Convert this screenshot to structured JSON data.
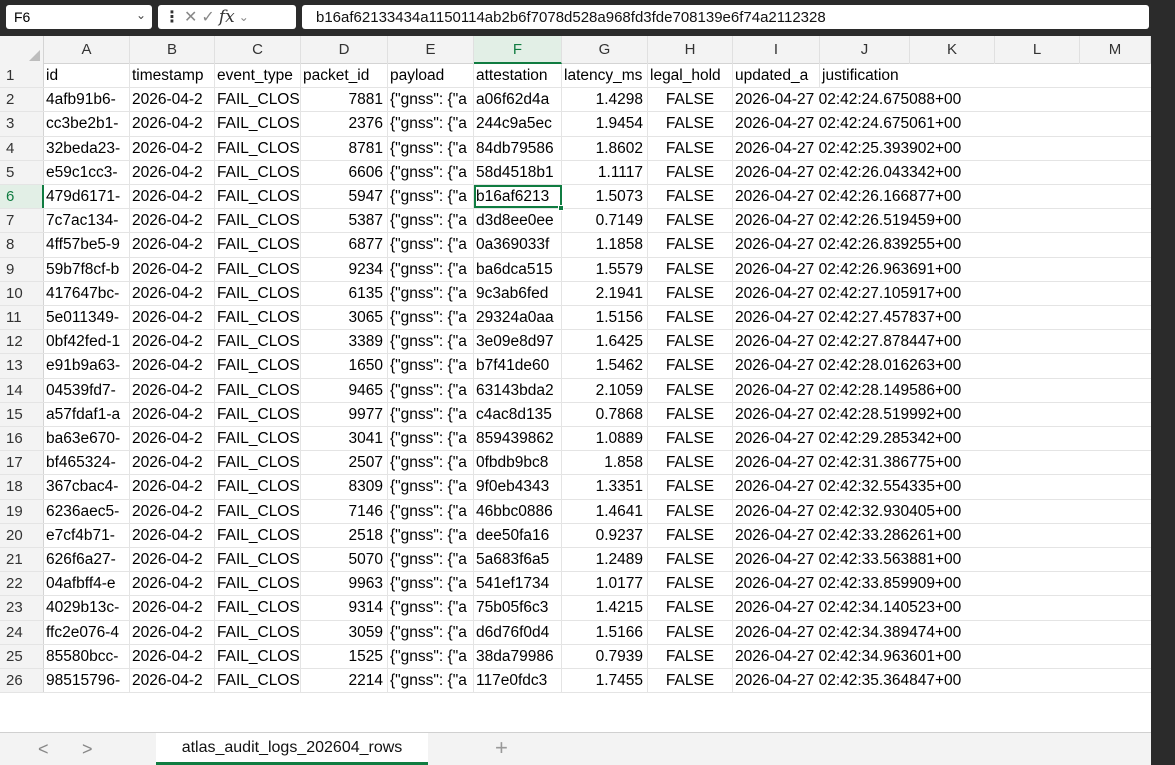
{
  "namebox": {
    "value": "F6"
  },
  "formula": {
    "value": "b16af62133434a1150114ab2b6f7078d528a968fd3fde708139e6f74a2112328",
    "fx_label": "fx"
  },
  "columns": [
    "A",
    "B",
    "C",
    "D",
    "E",
    "F",
    "G",
    "H",
    "I",
    "J",
    "K",
    "L",
    "M"
  ],
  "headers": [
    "id",
    "timestamp",
    "event_type",
    "packet_id",
    "payload",
    "attestation",
    "latency_ms",
    "legal_hold",
    "updated_a",
    "justification"
  ],
  "rows": [
    {
      "n": "2",
      "id": "4afb91b6-",
      "ts": "2026-04-2",
      "ev": "FAIL_CLOS",
      "pid": "7881",
      "pl": "{\"gnss\": {\"a",
      "att": "a06f62d4a",
      "lat": "1.4298",
      "lh": "FALSE",
      "upd": "2026-04-27 02:42:24.675088+00"
    },
    {
      "n": "3",
      "id": "cc3be2b1-",
      "ts": "2026-04-2",
      "ev": "FAIL_CLOS",
      "pid": "2376",
      "pl": "{\"gnss\": {\"a",
      "att": "244c9a5ec",
      "lat": "1.9454",
      "lh": "FALSE",
      "upd": "2026-04-27 02:42:24.675061+00"
    },
    {
      "n": "4",
      "id": "32beda23-",
      "ts": "2026-04-2",
      "ev": "FAIL_CLOS",
      "pid": "8781",
      "pl": "{\"gnss\": {\"a",
      "att": "84db79586",
      "lat": "1.8602",
      "lh": "FALSE",
      "upd": "2026-04-27 02:42:25.393902+00"
    },
    {
      "n": "5",
      "id": "e59c1cc3-",
      "ts": "2026-04-2",
      "ev": "FAIL_CLOS",
      "pid": "6606",
      "pl": "{\"gnss\": {\"a",
      "att": "58d4518b1",
      "lat": "1.1117",
      "lh": "FALSE",
      "upd": "2026-04-27 02:42:26.043342+00"
    },
    {
      "n": "6",
      "id": "479d6171-",
      "ts": "2026-04-2",
      "ev": "FAIL_CLOS",
      "pid": "5947",
      "pl": "{\"gnss\": {\"a",
      "att": "b16af6213",
      "lat": "1.5073",
      "lh": "FALSE",
      "upd": "2026-04-27 02:42:26.166877+00"
    },
    {
      "n": "7",
      "id": "7c7ac134-",
      "ts": "2026-04-2",
      "ev": "FAIL_CLOS",
      "pid": "5387",
      "pl": "{\"gnss\": {\"a",
      "att": "d3d8ee0ee",
      "lat": "0.7149",
      "lh": "FALSE",
      "upd": "2026-04-27 02:42:26.519459+00"
    },
    {
      "n": "8",
      "id": "4ff57be5-9",
      "ts": "2026-04-2",
      "ev": "FAIL_CLOS",
      "pid": "6877",
      "pl": "{\"gnss\": {\"a",
      "att": "0a369033f",
      "lat": "1.1858",
      "lh": "FALSE",
      "upd": "2026-04-27 02:42:26.839255+00"
    },
    {
      "n": "9",
      "id": "59b7f8cf-b",
      "ts": "2026-04-2",
      "ev": "FAIL_CLOS",
      "pid": "9234",
      "pl": "{\"gnss\": {\"a",
      "att": "ba6dca515",
      "lat": "1.5579",
      "lh": "FALSE",
      "upd": "2026-04-27 02:42:26.963691+00"
    },
    {
      "n": "10",
      "id": "417647bc-",
      "ts": "2026-04-2",
      "ev": "FAIL_CLOS",
      "pid": "6135",
      "pl": "{\"gnss\": {\"a",
      "att": "9c3ab6fed",
      "lat": "2.1941",
      "lh": "FALSE",
      "upd": "2026-04-27 02:42:27.105917+00"
    },
    {
      "n": "11",
      "id": "5e011349-",
      "ts": "2026-04-2",
      "ev": "FAIL_CLOS",
      "pid": "3065",
      "pl": "{\"gnss\": {\"a",
      "att": "29324a0aa",
      "lat": "1.5156",
      "lh": "FALSE",
      "upd": "2026-04-27 02:42:27.457837+00"
    },
    {
      "n": "12",
      "id": "0bf42fed-1",
      "ts": "2026-04-2",
      "ev": "FAIL_CLOS",
      "pid": "3389",
      "pl": "{\"gnss\": {\"a",
      "att": "3e09e8d97",
      "lat": "1.6425",
      "lh": "FALSE",
      "upd": "2026-04-27 02:42:27.878447+00"
    },
    {
      "n": "13",
      "id": "e91b9a63-",
      "ts": "2026-04-2",
      "ev": "FAIL_CLOS",
      "pid": "1650",
      "pl": "{\"gnss\": {\"a",
      "att": "b7f41de60",
      "lat": "1.5462",
      "lh": "FALSE",
      "upd": "2026-04-27 02:42:28.016263+00"
    },
    {
      "n": "14",
      "id": "04539fd7-",
      "ts": "2026-04-2",
      "ev": "FAIL_CLOS",
      "pid": "9465",
      "pl": "{\"gnss\": {\"a",
      "att": "63143bda2",
      "lat": "2.1059",
      "lh": "FALSE",
      "upd": "2026-04-27 02:42:28.149586+00"
    },
    {
      "n": "15",
      "id": "a57fdaf1-a",
      "ts": "2026-04-2",
      "ev": "FAIL_CLOS",
      "pid": "9977",
      "pl": "{\"gnss\": {\"a",
      "att": "c4ac8d135",
      "lat": "0.7868",
      "lh": "FALSE",
      "upd": "2026-04-27 02:42:28.519992+00"
    },
    {
      "n": "16",
      "id": "ba63e670-",
      "ts": "2026-04-2",
      "ev": "FAIL_CLOS",
      "pid": "3041",
      "pl": "{\"gnss\": {\"a",
      "att": "859439862",
      "lat": "1.0889",
      "lh": "FALSE",
      "upd": "2026-04-27 02:42:29.285342+00"
    },
    {
      "n": "17",
      "id": "bf465324-",
      "ts": "2026-04-2",
      "ev": "FAIL_CLOS",
      "pid": "2507",
      "pl": "{\"gnss\": {\"a",
      "att": "0fbdb9bc8",
      "lat": "1.858",
      "lh": "FALSE",
      "upd": "2026-04-27 02:42:31.386775+00"
    },
    {
      "n": "18",
      "id": "367cbac4-",
      "ts": "2026-04-2",
      "ev": "FAIL_CLOS",
      "pid": "8309",
      "pl": "{\"gnss\": {\"a",
      "att": "9f0eb4343",
      "lat": "1.3351",
      "lh": "FALSE",
      "upd": "2026-04-27 02:42:32.554335+00"
    },
    {
      "n": "19",
      "id": "6236aec5-",
      "ts": "2026-04-2",
      "ev": "FAIL_CLOS",
      "pid": "7146",
      "pl": "{\"gnss\": {\"a",
      "att": "46bbc0886",
      "lat": "1.4641",
      "lh": "FALSE",
      "upd": "2026-04-27 02:42:32.930405+00"
    },
    {
      "n": "20",
      "id": "e7cf4b71-",
      "ts": "2026-04-2",
      "ev": "FAIL_CLOS",
      "pid": "2518",
      "pl": "{\"gnss\": {\"a",
      "att": "dee50fa16",
      "lat": "0.9237",
      "lh": "FALSE",
      "upd": "2026-04-27 02:42:33.286261+00"
    },
    {
      "n": "21",
      "id": "626f6a27-",
      "ts": "2026-04-2",
      "ev": "FAIL_CLOS",
      "pid": "5070",
      "pl": "{\"gnss\": {\"a",
      "att": "5a683f6a5",
      "lat": "1.2489",
      "lh": "FALSE",
      "upd": "2026-04-27 02:42:33.563881+00"
    },
    {
      "n": "22",
      "id": "04afbff4-e",
      "ts": "2026-04-2",
      "ev": "FAIL_CLOS",
      "pid": "9963",
      "pl": "{\"gnss\": {\"a",
      "att": "541ef1734",
      "lat": "1.0177",
      "lh": "FALSE",
      "upd": "2026-04-27 02:42:33.859909+00"
    },
    {
      "n": "23",
      "id": "4029b13c-",
      "ts": "2026-04-2",
      "ev": "FAIL_CLOS",
      "pid": "9314",
      "pl": "{\"gnss\": {\"a",
      "att": "75b05f6c3",
      "lat": "1.4215",
      "lh": "FALSE",
      "upd": "2026-04-27 02:42:34.140523+00"
    },
    {
      "n": "24",
      "id": "ffc2e076-4",
      "ts": "2026-04-2",
      "ev": "FAIL_CLOS",
      "pid": "3059",
      "pl": "{\"gnss\": {\"a",
      "att": "d6d76f0d4",
      "lat": "1.5166",
      "lh": "FALSE",
      "upd": "2026-04-27 02:42:34.389474+00"
    },
    {
      "n": "25",
      "id": "85580bcc-",
      "ts": "2026-04-2",
      "ev": "FAIL_CLOS",
      "pid": "1525",
      "pl": "{\"gnss\": {\"a",
      "att": "38da79986",
      "lat": "0.7939",
      "lh": "FALSE",
      "upd": "2026-04-27 02:42:34.963601+00"
    },
    {
      "n": "26",
      "id": "98515796-",
      "ts": "2026-04-2",
      "ev": "FAIL_CLOS",
      "pid": "2214",
      "pl": "{\"gnss\": {\"a",
      "att": "117e0fdc3",
      "lat": "1.7455",
      "lh": "FALSE",
      "upd": "2026-04-27 02:42:35.364847+00"
    }
  ],
  "selected": {
    "row": "6",
    "col": "F"
  },
  "tabs": {
    "active": "atlas_audit_logs_202604_rows",
    "add_label": "+",
    "prev_label": "<",
    "next_label": ">"
  },
  "colors": {
    "accent": "#107c41",
    "selected_header_bg": "#e2efe6"
  }
}
